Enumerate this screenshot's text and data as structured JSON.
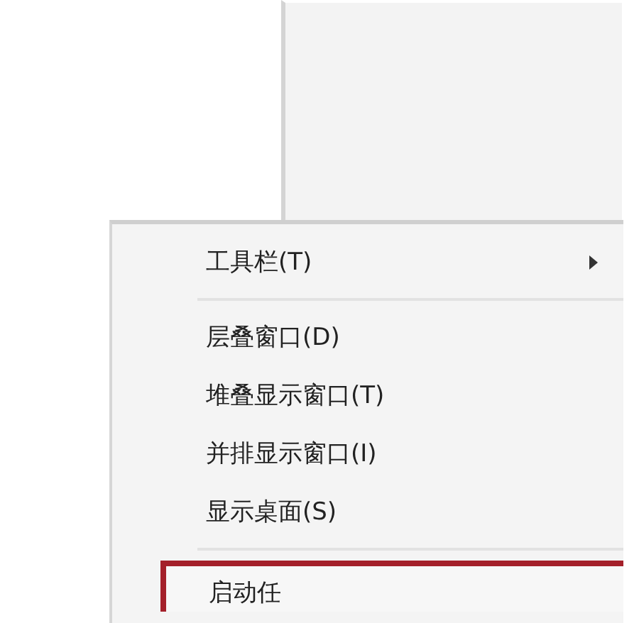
{
  "menu": {
    "items": [
      {
        "kind": "submenu",
        "label": "工具栏(T)",
        "highlighted": false
      },
      {
        "kind": "separator"
      },
      {
        "kind": "item",
        "label": "层叠窗口(D)",
        "highlighted": false
      },
      {
        "kind": "item",
        "label": "堆叠显示窗口(T)",
        "highlighted": false
      },
      {
        "kind": "item",
        "label": "并排显示窗口(I)",
        "highlighted": false
      },
      {
        "kind": "item",
        "label": "显示桌面(S)",
        "highlighted": false
      },
      {
        "kind": "separator"
      },
      {
        "kind": "item",
        "label": "启动任",
        "highlighted": true
      }
    ]
  }
}
